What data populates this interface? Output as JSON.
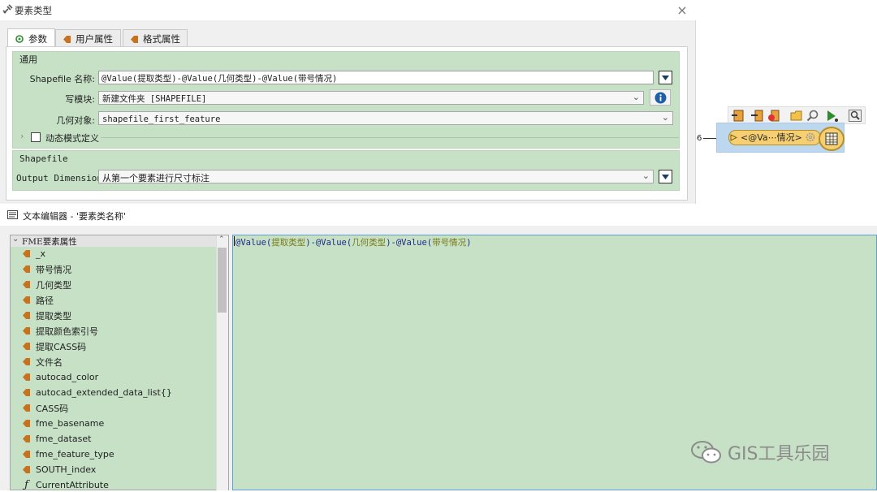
{
  "dialog": {
    "title": "要素类型",
    "icon": "fme-transformer-icon",
    "close": "×",
    "tabs": [
      {
        "label": "参数",
        "icon": "gear-icon"
      },
      {
        "label": "用户属性",
        "icon": "attribute-icon"
      },
      {
        "label": "格式属性",
        "icon": "attribute-icon"
      }
    ],
    "general_group": "通用",
    "shapefile_name_label": "Shapefile 名称:",
    "shapefile_name_value": "@Value(提取类型)-@Value(几何类型)-@Value(带号情况)",
    "writer_label": "写模块:",
    "writer_value": "新建文件夹  [SHAPEFILE]",
    "geometry_label": "几何对象:",
    "geometry_value": "shapefile_first_feature",
    "dynamic_label": "动态模式定义",
    "shapefile_group": "Shapefile",
    "output_dim_label": "Output Dimension:",
    "output_dim_value": "从第一个要素进行尺寸标注"
  },
  "canvas": {
    "connection_count": "6",
    "node_label": "<@Va⋯情况>"
  },
  "editor": {
    "title": "文本编辑器 - '要素类名称'",
    "tree_root": "FME要素属性",
    "tree_items": [
      "_x",
      "带号情况",
      "几何类型",
      "路径",
      "提取类型",
      "提取颜色索引号",
      "提取CASS码",
      "文件名",
      "autocad_color",
      "autocad_extended_data_list{}",
      "CASS码",
      "fme_basename",
      "fme_dataset",
      "fme_feature_type",
      "SOUTH_index",
      "CurrentAttribute"
    ],
    "expression": {
      "fn": "@Value",
      "arg1": "提取类型",
      "arg2": "几何类型",
      "arg3": "带号情况"
    }
  },
  "watermark": "GIS工具乐园",
  "colors": {
    "panel_green": "#c6e1c5",
    "attr_icon": "#c8721e",
    "node_yellow": "#f6cf72",
    "selection_blue": "#bcd7ee",
    "info_blue": "#1f5fa8"
  }
}
